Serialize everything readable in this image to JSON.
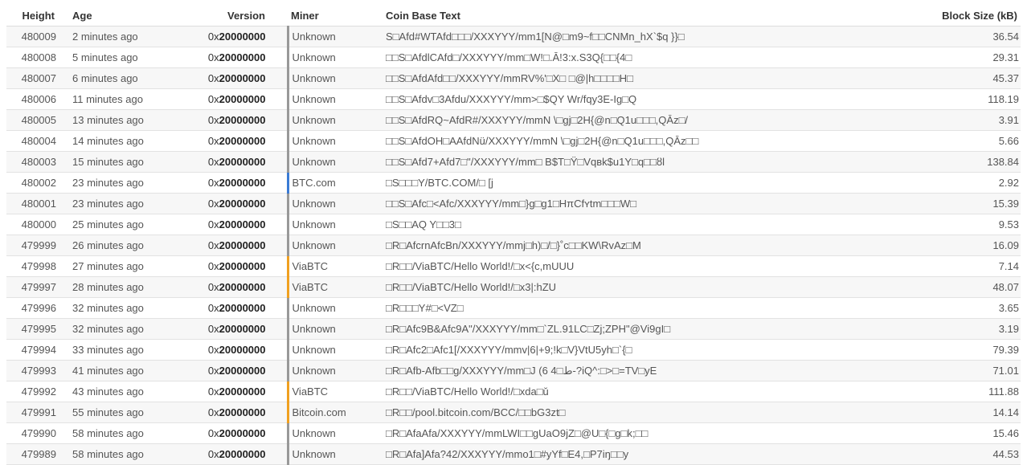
{
  "columns": {
    "height": "Height",
    "age": "Age",
    "version": "Version",
    "miner": "Miner",
    "coinbase": "Coin Base Text",
    "size": "Block Size (kB)"
  },
  "version_prefix": "0x",
  "miner_colors": {
    "BTC.com": "#3a7bd5",
    "ViaBTC": "#f0a020",
    "Bitcoin.com": "#f0a020",
    "Unknown": "#999999"
  },
  "rows": [
    {
      "height": "480009",
      "age": "2 minutes ago",
      "version": "20000000",
      "miner": "Unknown",
      "coinbase": " S□Afd#WTAfd□□□/XXXYYY/mm1[N@□m9~f□□CNMn_hX`$q }}□",
      "size": "36.54"
    },
    {
      "height": "480008",
      "age": "5 minutes ago",
      "version": "20000000",
      "miner": "Unknown",
      "coinbase": "□□S□AfdlCAfd□/XXXYYY/mm□W!□.Ā!3:x.S3Q{□□{4□",
      "size": "29.31"
    },
    {
      "height": "480007",
      "age": "6 minutes ago",
      "version": "20000000",
      "miner": "Unknown",
      "coinbase": "□□S□AfdAfd□□/XXXYYY/mmRV%'□X□ □@|h□□□□H□",
      "size": "45.37"
    },
    {
      "height": "480006",
      "age": "11 minutes ago",
      "version": "20000000",
      "miner": "Unknown",
      "coinbase": "□□S□Afdv□3Afdu/XXXYYY/mm>□$QY Wr/fqy3E-Ig□Q",
      "size": "118.19"
    },
    {
      "height": "480005",
      "age": "13 minutes ago",
      "version": "20000000",
      "miner": "Unknown",
      "coinbase": "□□S□AfdRQ~AfdR#/XXXYYY/mmN \\□gj□2H{@n□Q1u□□□,QĀz□/",
      "size": "3.91"
    },
    {
      "height": "480004",
      "age": "14 minutes ago",
      "version": "20000000",
      "miner": "Unknown",
      "coinbase": "□□S□AfdOH□AAfdNü/XXXYYY/mmN \\□gj□2H{@n□Q1u□□□,QĀz□□",
      "size": "5.66"
    },
    {
      "height": "480003",
      "age": "15 minutes ago",
      "version": "20000000",
      "miner": "Unknown",
      "coinbase": "□□S□Afd7+Afd7□\"/XXXYYY/mm□ B$T□Ÿ□Vqвk$u1Y□q□□ȣl",
      "size": "138.84"
    },
    {
      "height": "480002",
      "age": "23 minutes ago",
      "version": "20000000",
      "miner": "BTC.com",
      "coinbase": "□S□□□Y/BTC.COM/□ [j",
      "size": "2.92"
    },
    {
      "height": "480001",
      "age": "23 minutes ago",
      "version": "20000000",
      "miner": "Unknown",
      "coinbase": "□□S□Afc□<Afc/XXXYYY/mm□}g□g1□HπCfʏtm□□□W□",
      "size": "15.39"
    },
    {
      "height": "480000",
      "age": "25 minutes ago",
      "version": "20000000",
      "miner": "Unknown",
      "coinbase": "□S□□AQ Y□□3□",
      "size": "9.53"
    },
    {
      "height": "479999",
      "age": "26 minutes ago",
      "version": "20000000",
      "miner": "Unknown",
      "coinbase": "□R□AfcrnAfcBn/XXXYYY/mmj□h)□/□}˚c□□KW\\RvAz□M",
      "size": "16.09"
    },
    {
      "height": "479998",
      "age": "27 minutes ago",
      "version": "20000000",
      "miner": "ViaBTC",
      "coinbase": "□R□□/ViaBTC/Hello World!/□x<{c,mUUU",
      "size": "7.14"
    },
    {
      "height": "479997",
      "age": "28 minutes ago",
      "version": "20000000",
      "miner": "ViaBTC",
      "coinbase": "□R□□/ViaBTC/Hello World!/□x3|:hZU",
      "size": "48.07"
    },
    {
      "height": "479996",
      "age": "32 minutes ago",
      "version": "20000000",
      "miner": "Unknown",
      "coinbase": "□R□□□Y#□<VZ□",
      "size": "3.65"
    },
    {
      "height": "479995",
      "age": "32 minutes ago",
      "version": "20000000",
      "miner": "Unknown",
      "coinbase": "□R□Afc9B&Afc9A\"/XXXYYY/mm□`ZL.91LC□Zj;ZPH\"@Vi9gI□",
      "size": "3.19"
    },
    {
      "height": "479994",
      "age": "33 minutes ago",
      "version": "20000000",
      "miner": "Unknown",
      "coinbase": "□R□Afc2□Afc1[/XXXYYY/mmv|6|+9;!k□V}VtU5yh□`{□",
      "size": "79.39"
    },
    {
      "height": "479993",
      "age": "41 minutes ago",
      "version": "20000000",
      "miner": "Unknown",
      "coinbase": "□R□Afb-Afb□□g/XXXYYY/mm□J (6 4□ط-?iQ^:□>□=TV□yE",
      "size": "71.01"
    },
    {
      "height": "479992",
      "age": "43 minutes ago",
      "version": "20000000",
      "miner": "ViaBTC",
      "coinbase": "□R□□/ViaBTC/Hello World!/□xda□ǔ",
      "size": "111.88"
    },
    {
      "height": "479991",
      "age": "55 minutes ago",
      "version": "20000000",
      "miner": "Bitcoin.com",
      "coinbase": "□R□□/pool.bitcoin.com/BCC/□□bG3zt□",
      "size": "14.14"
    },
    {
      "height": "479990",
      "age": "58 minutes ago",
      "version": "20000000",
      "miner": "Unknown",
      "coinbase": "□R□AfaAfa/XXXYYY/mmLWI□□gUaO9jZ□@U□{□g□k;□□",
      "size": "15.46"
    },
    {
      "height": "479989",
      "age": "58 minutes ago",
      "version": "20000000",
      "miner": "Unknown",
      "coinbase": "□R□Afa]Afa?42/XXXYYY/mmo1□#yYf□E4,□P7iŋ□□y",
      "size": "44.53"
    }
  ]
}
